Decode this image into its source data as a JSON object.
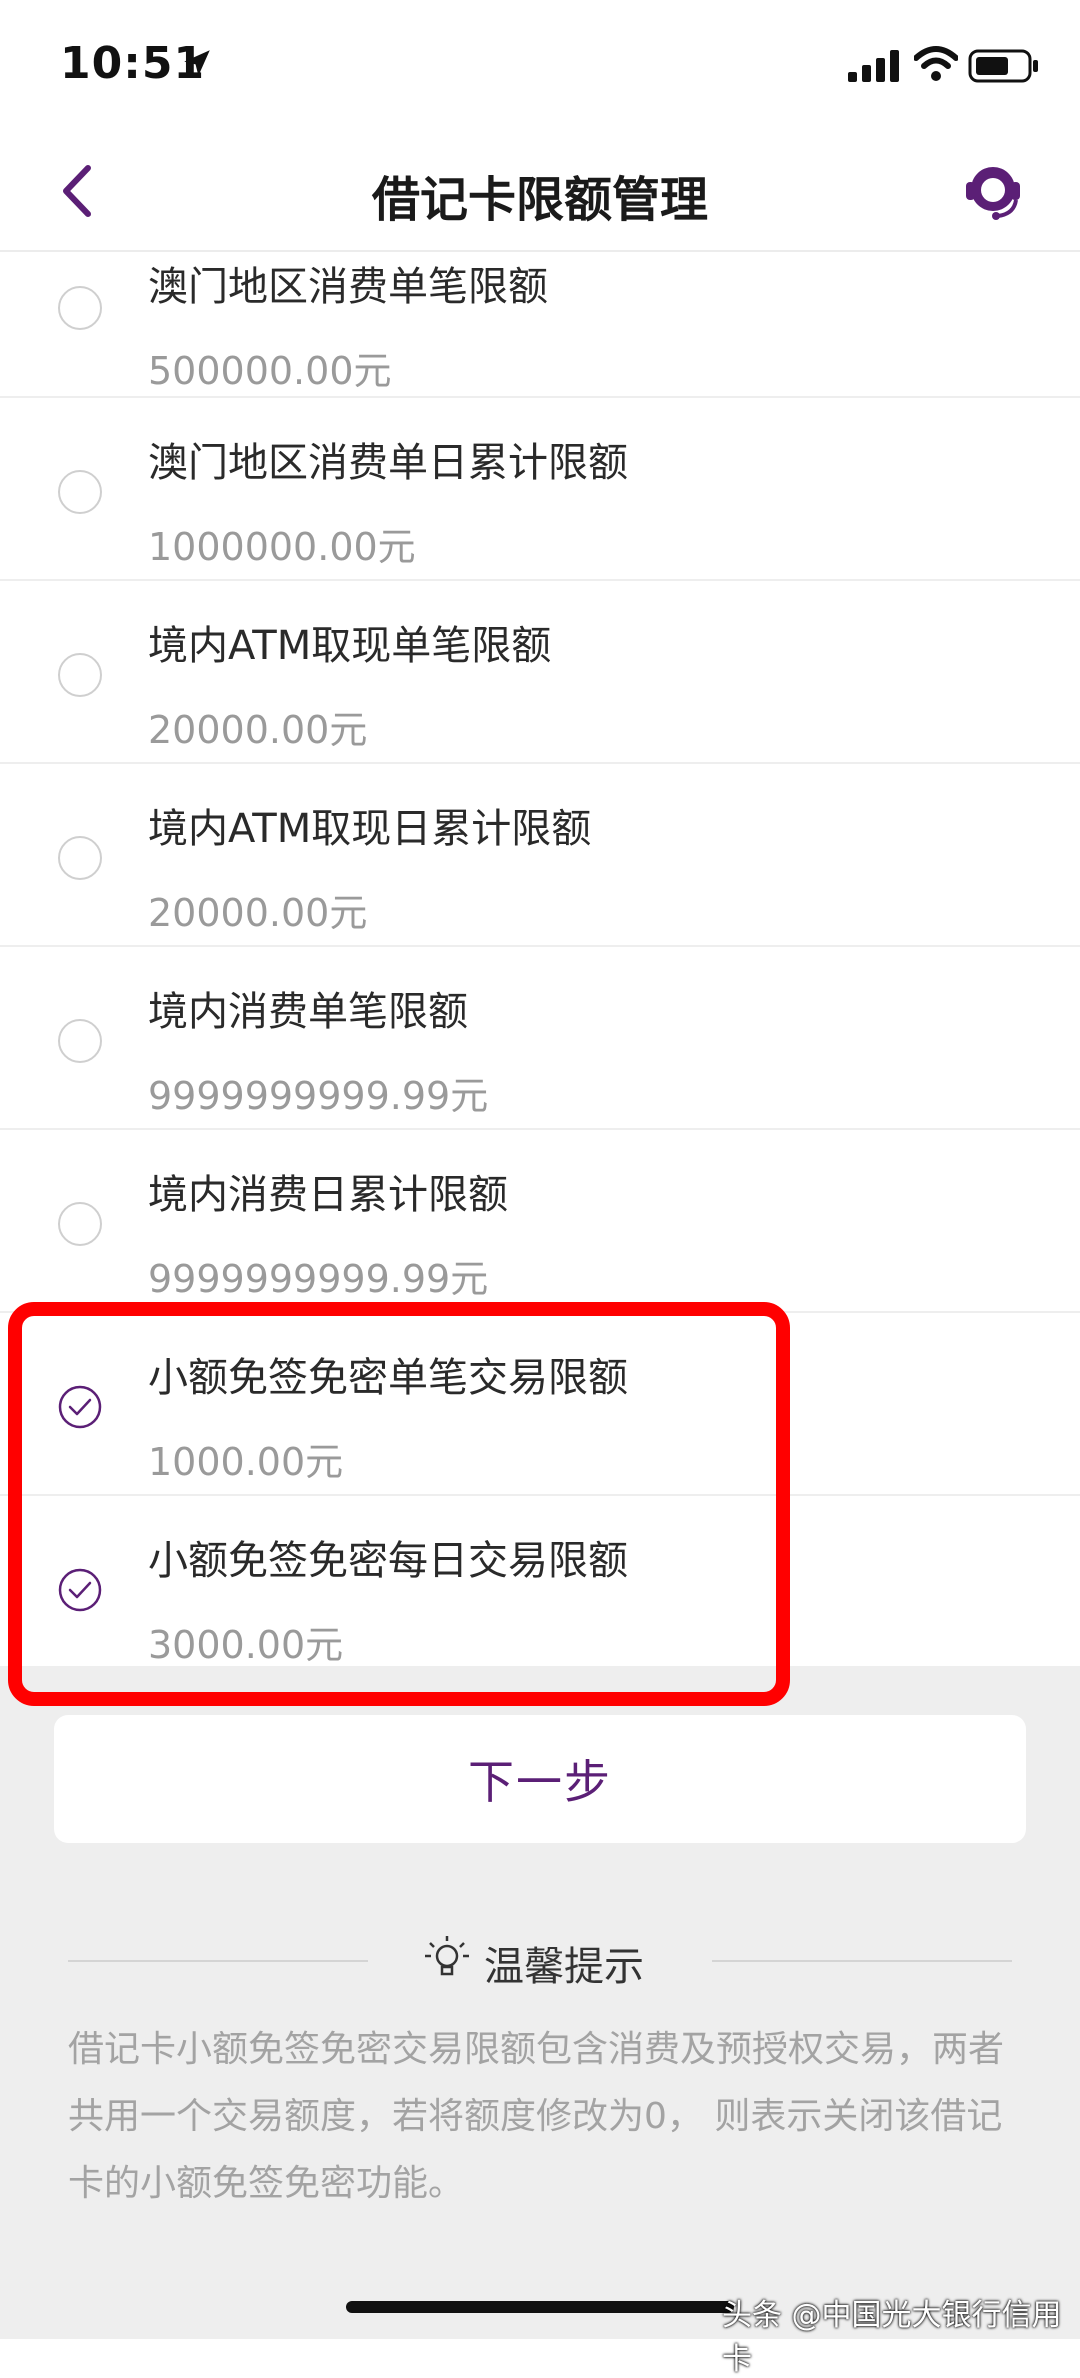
{
  "status_bar": {
    "time": "10:51"
  },
  "nav": {
    "title": "借记卡限额管理"
  },
  "limits": [
    {
      "label": "澳门地区消费单笔限额",
      "value": "500000.00元",
      "checked": false
    },
    {
      "label": "澳门地区消费单日累计限额",
      "value": "1000000.00元",
      "checked": false
    },
    {
      "label": "境内ATM取现单笔限额",
      "value": "20000.00元",
      "checked": false
    },
    {
      "label": "境内ATM取现日累计限额",
      "value": "20000.00元",
      "checked": false
    },
    {
      "label": "境内消费单笔限额",
      "value": "9999999999.99元",
      "checked": false
    },
    {
      "label": "境内消费日累计限额",
      "value": "9999999999.99元",
      "checked": false
    },
    {
      "label": "小额免签免密单笔交易限额",
      "value": "1000.00元",
      "checked": true
    },
    {
      "label": "小额免签免密每日交易限额",
      "value": "3000.00元",
      "checked": true
    }
  ],
  "next_button": "下一步",
  "tips": {
    "title": "温馨提示",
    "text": "借记卡小额免签免密交易限额包含消费及预授权交易，两者共用一个交易额度，若将额度修改为0， 则表示关闭该借记卡的小额免签免密功能。"
  },
  "watermark": "头条 @中国光大银行信用卡",
  "colors": {
    "accent": "#5b1f76",
    "highlight": "#ff0000"
  }
}
